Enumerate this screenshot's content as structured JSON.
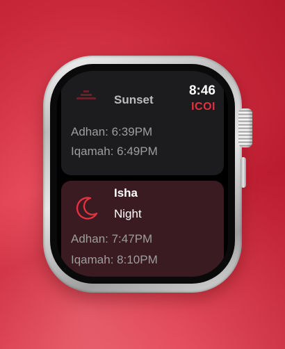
{
  "status": {
    "time": "8:46",
    "brand": "ICOI"
  },
  "prayers": [
    {
      "name": "Sunset",
      "adhan": "Adhan: 6:39PM",
      "iqamah": "Iqamah: 6:49PM"
    },
    {
      "name": "Isha",
      "label": "Night",
      "adhan": "Adhan: 7:47PM",
      "iqamah": "Iqamah: 8:10PM",
      "icon": "moon-icon"
    }
  ],
  "colors": {
    "accent": "#e4313f",
    "highlight_card": "#3a1b22",
    "card": "#1c1c1e"
  }
}
